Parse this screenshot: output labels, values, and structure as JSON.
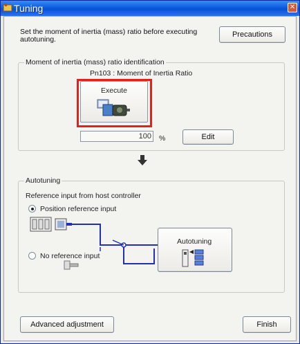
{
  "window": {
    "title": "Tuning",
    "close_glyph": "✕"
  },
  "intro": {
    "text": "Set the moment of inertia (mass) ratio before executing autotuning.",
    "precautions_label": "Precautions"
  },
  "identification": {
    "legend": "Moment of inertia (mass) ratio identification",
    "parameter_label": "Pn103 : Moment of Inertia Ratio",
    "execute_label": "Execute",
    "progress_value": "100",
    "progress_unit": "%",
    "edit_label": "Edit"
  },
  "flow_arrow_icon": "down-arrow-icon",
  "autotuning": {
    "legend": "Autotuning",
    "reference_heading": "Reference input from host controller",
    "options": [
      {
        "label": "Position reference input",
        "selected": true
      },
      {
        "label": "No reference input",
        "selected": false
      }
    ],
    "autotuning_button_label": "Autotuning"
  },
  "footer": {
    "advanced_label": "Advanced adjustment",
    "finish_label": "Finish"
  },
  "colors": {
    "title_bar": "#0a5fe0",
    "highlight": "#e0211c",
    "wiring": "#1f2fb8"
  }
}
